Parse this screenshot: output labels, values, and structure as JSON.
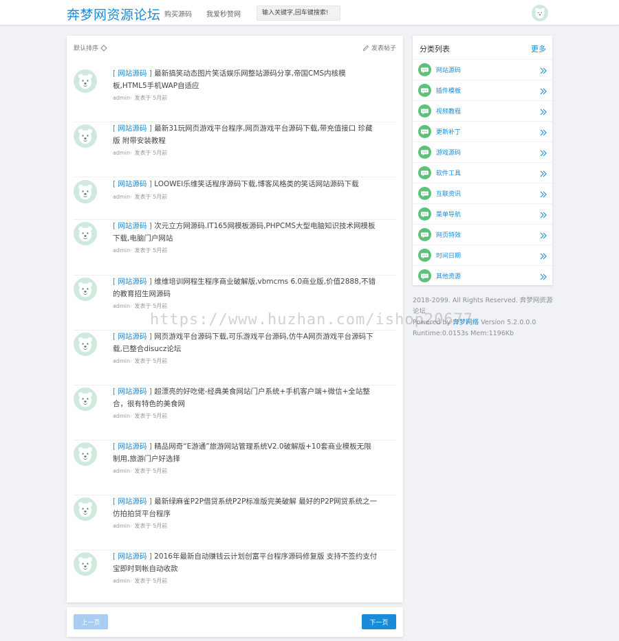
{
  "header": {
    "logo": "奔梦网资源论坛",
    "nav": [
      "购买源码",
      "我爱秒赞网"
    ],
    "search_placeholder": "输入关键字,回车键搜索!"
  },
  "main": {
    "sort_label": "默认排序",
    "post_button": "发表帖子",
    "posts": [
      {
        "category": "[ 网站源码 ]",
        "title": "最新搞笑动态图片笑话娱乐网整站源码分享,帝国CMS内核模板,HTML5手机WAP自适应",
        "author": "admin·",
        "meta": "发表于 5月前"
      },
      {
        "category": "[ 网站源码 ]",
        "title": "最新31玩网页游戏平台程序,网页游戏平台源码下载,带充值接口 珍藏版 附带安装教程",
        "author": "admin·",
        "meta": "发表于 5月前"
      },
      {
        "category": "[ 网站源码 ]",
        "title": "LOOWEI乐维笑话程序源码下载,博客风格类的笑话网站源码下载",
        "author": "admin·",
        "meta": "发表于 5月前"
      },
      {
        "category": "[ 网站源码 ]",
        "title": "次元立方网源码.IT165网模板源码,PHPCMS大型电脑知识技术网模板下载,电脑门户网站",
        "author": "admin·",
        "meta": "发表于 5月前"
      },
      {
        "category": "[ 网站源码 ]",
        "title": "维维培训网程生程序商业破解版,vbmcms 6.0商业版,价值2888,不错的教育招生网源码",
        "author": "admin·",
        "meta": "发表于 5月前"
      },
      {
        "category": "[ 网站源码 ]",
        "title": "网页游戏平台源码下载,可乐游戏平台源码,仿牛A网页游戏平台源码下载,已整合disucz论坛",
        "author": "admin·",
        "meta": "发表于 5月前"
      },
      {
        "category": "[ 网站源码 ]",
        "title": "超漂亮的好吃佬-经典美食网站门户系统+手机客户端+微信+全站整合，很有特色的美食网",
        "author": "admin·",
        "meta": "发表于 5月前"
      },
      {
        "category": "[ 网站源码 ]",
        "title": "精品网奇“E游通”旅游网站管理系统V2.0破解版+10套商业模板无限制用,旅游门户好选择",
        "author": "admin·",
        "meta": "发表于 5月前"
      },
      {
        "category": "[ 网站源码 ]",
        "title": "最新绿麻雀P2P借贷系统P2P标准版完美破解 最好的P2P网贷系统之一 仿拍拍贷平台程序",
        "author": "admin·",
        "meta": "发表于 5月前"
      },
      {
        "category": "[ 网站源码 ]",
        "title": "2016年最新自动赚钱云计划创富平台程序源码修复版 支持不签约支付宝即时到帐自动收款",
        "author": "admin·",
        "meta": "发表于 5月前"
      }
    ]
  },
  "pager": {
    "prev": "上一页",
    "next": "下一页"
  },
  "sidebar": {
    "title": "分类列表",
    "more": "更多",
    "items": [
      "网站源码",
      "插件模板",
      "视频教程",
      "更新补丁",
      "游戏源码",
      "软件工具",
      "互联资讯",
      "菜单导航",
      "网页特效",
      "时间日期",
      "其他资源"
    ]
  },
  "footer": {
    "line1": "2018-2099. All Rights Reserved. 奔梦网资源论坛",
    "powered_prefix": "Powered by",
    "powered_link": "奔梦网络",
    "version": "Version 5.2.0.0.0",
    "runtime": "Runtime:0.0153s Mem:1196Kb"
  },
  "watermark": "https://www.huzhan.com/ishop20677",
  "colors": {
    "accent": "#1a8bd6",
    "green_icon": "#5cc27a",
    "background": "#f0f2f5"
  }
}
